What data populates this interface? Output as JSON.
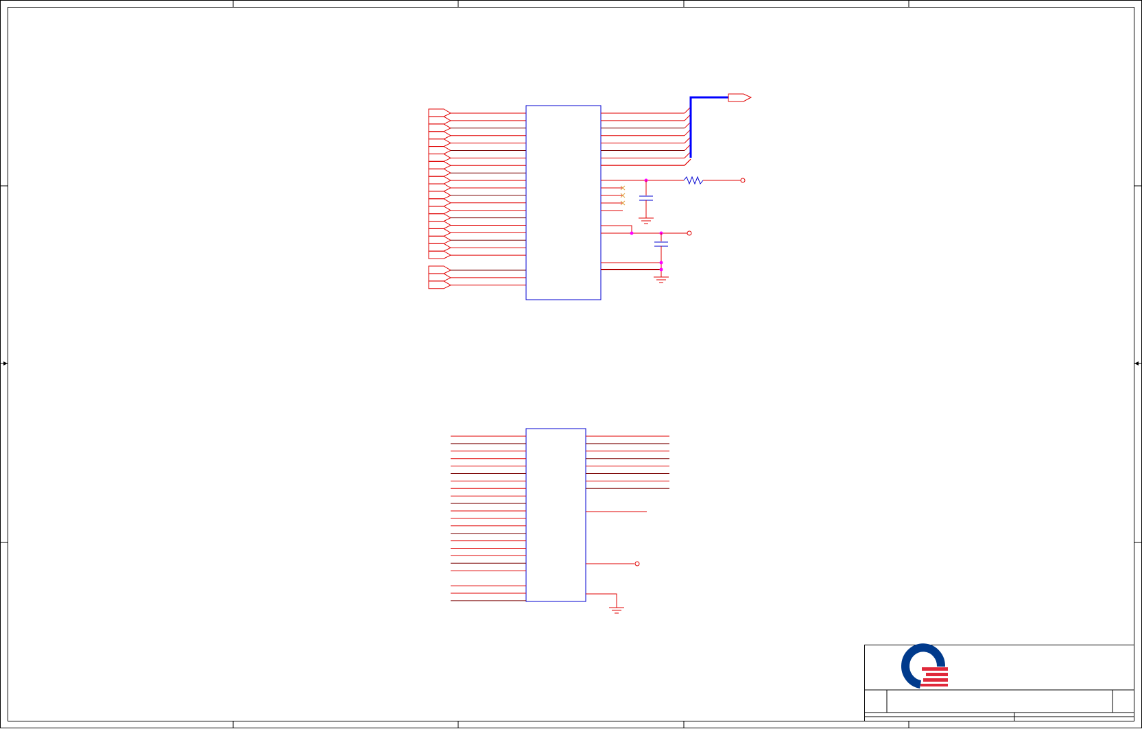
{
  "schematic": {
    "colors": {
      "wire": "#e00000",
      "wire_dark": "#7a0000",
      "component": "#0000d0",
      "bus": "#0000ff",
      "junction": "#ff00ff",
      "frame": "#000000",
      "logo_blue": "#003a8c",
      "logo_red": "#e0283a"
    },
    "upper_block": {
      "left_pin_count": 20,
      "left_group2_pin_count": 3,
      "right_bus_pin_count": 8
    },
    "lower_block": {
      "left_pin_count": 22,
      "right_pin_count": 8
    },
    "icons": [
      "resistor-icon",
      "capacitor-icon",
      "ground-icon",
      "off-page-connector-icon",
      "no-connect-icon",
      "company-logo-icon"
    ]
  }
}
